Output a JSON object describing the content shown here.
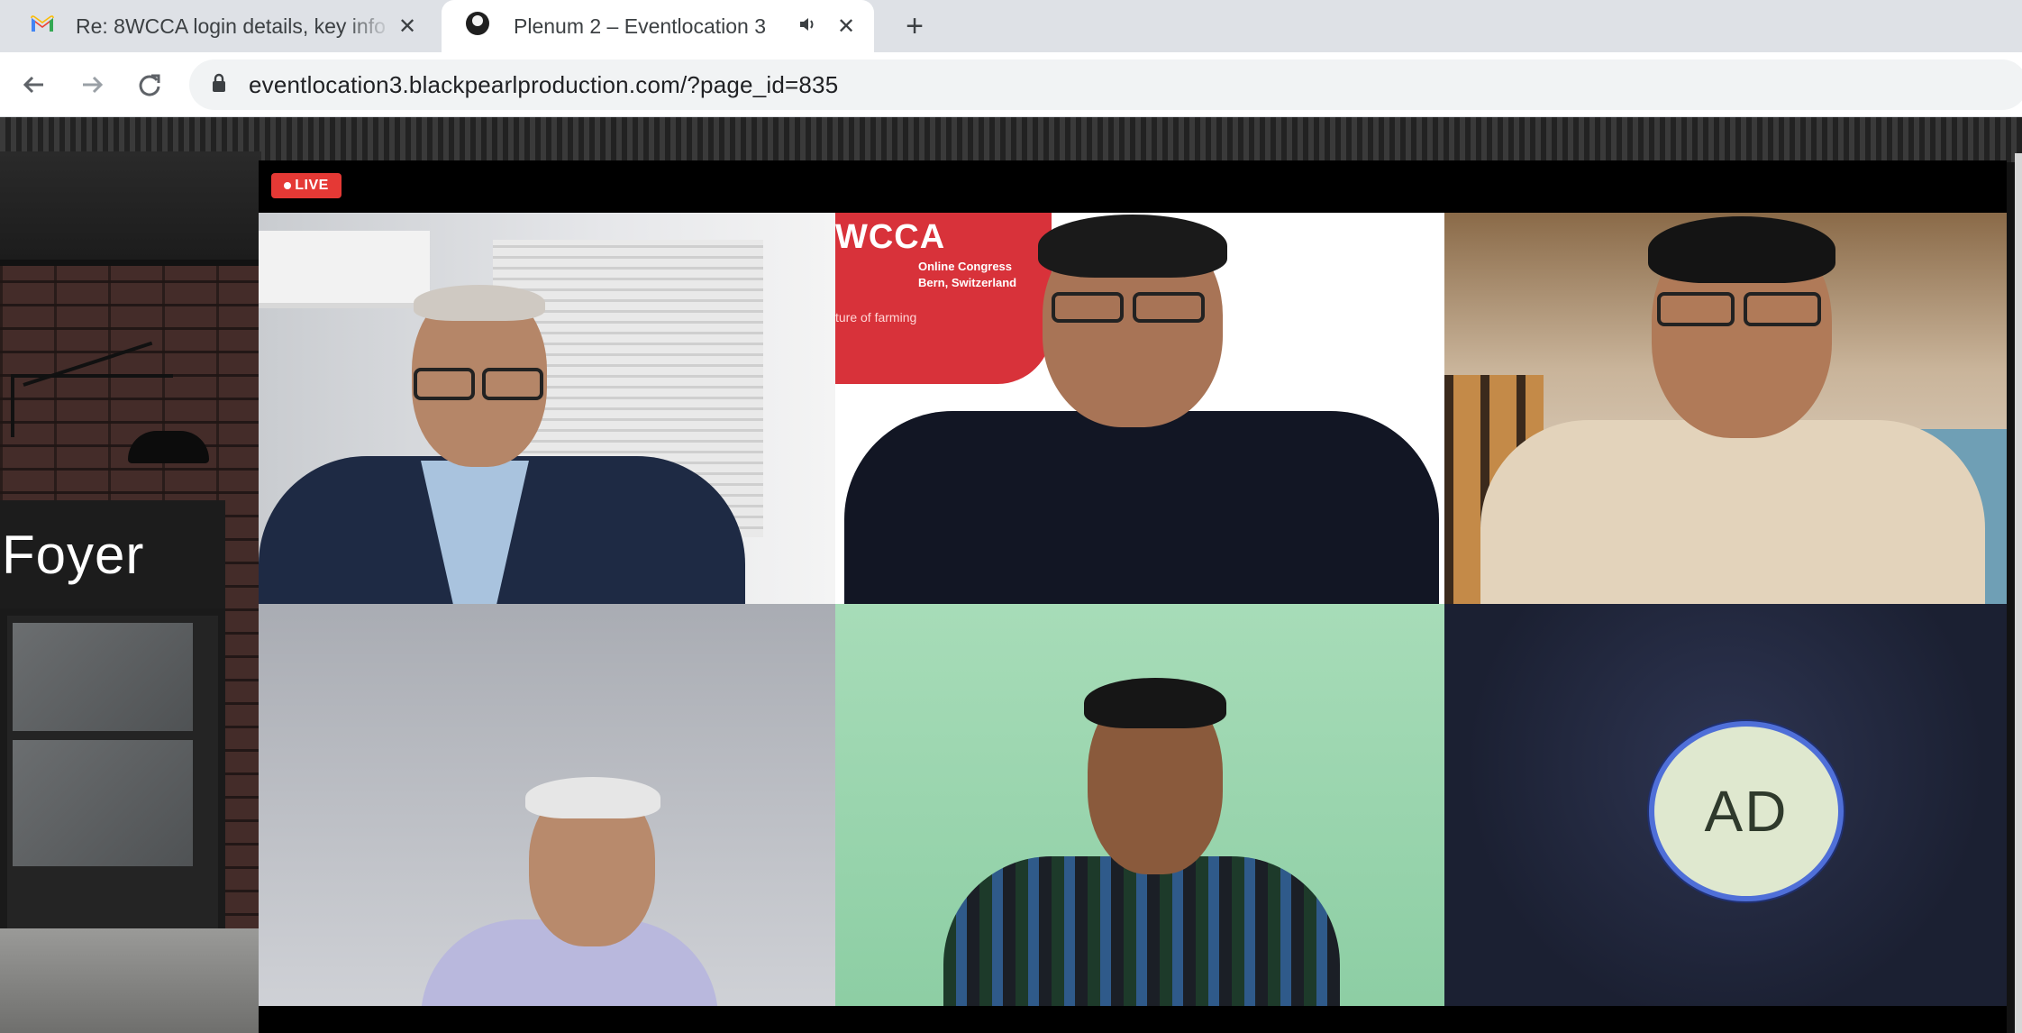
{
  "browser": {
    "tabs": [
      {
        "title": "Re: 8WCCA login details, key info",
        "favicon": "gmail-icon",
        "active": false
      },
      {
        "title": "Plenum 2 – Eventlocation 3",
        "favicon": "site-icon",
        "active": true,
        "audio": true
      }
    ],
    "url": "eventlocation3.blackpearlproduction.com/?page_id=835"
  },
  "venue": {
    "room_sign": "Foyer"
  },
  "stream": {
    "live_label": "LIVE",
    "participants": [
      {
        "type": "video",
        "backdrop": "office-window"
      },
      {
        "type": "video",
        "backdrop": "congress-banner"
      },
      {
        "type": "video",
        "backdrop": "office-loft"
      },
      {
        "type": "video",
        "backdrop": "grey-wall"
      },
      {
        "type": "video",
        "backdrop": "green-wall"
      },
      {
        "type": "avatar",
        "initials": "AD"
      }
    ],
    "banner": {
      "logo": "WCCA",
      "line1": "Online Congress",
      "line2": "Bern, Switzerland",
      "tagline": "ture of farming"
    }
  },
  "colors": {
    "live_red": "#e53935",
    "avatar_ring": "#4f6fd8",
    "avatar_fill": "#dfe8cf",
    "banner_red": "#d8323a"
  }
}
